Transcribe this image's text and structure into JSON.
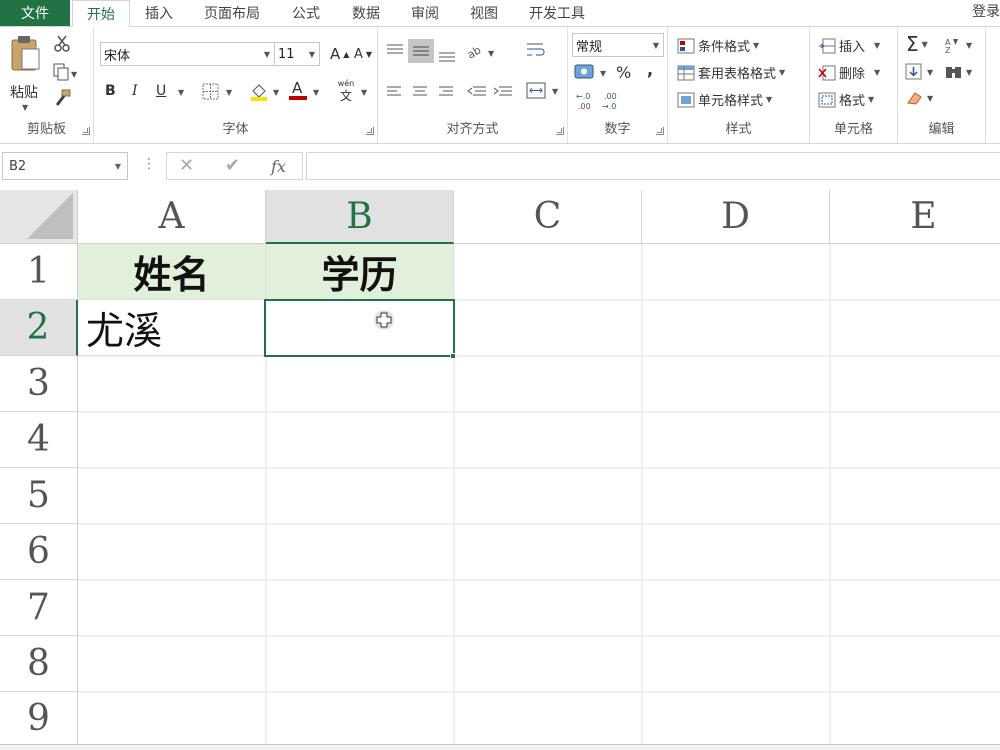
{
  "tabs": {
    "file": "文件",
    "home": "开始",
    "insert": "插入",
    "page_layout": "页面布局",
    "formulas": "公式",
    "data": "数据",
    "review": "审阅",
    "view": "视图",
    "developer": "开发工具",
    "login": "登录"
  },
  "ribbon": {
    "clipboard": {
      "paste": "粘贴",
      "label": "剪贴板"
    },
    "font": {
      "name": "宋体",
      "size": "11",
      "bold": "B",
      "italic": "I",
      "underline": "U",
      "grow": "A",
      "shrink": "A",
      "phonetic_top": "wén",
      "phonetic_bottom": "文",
      "color_letter": "A",
      "label": "字体"
    },
    "alignment": {
      "label": "对齐方式"
    },
    "number": {
      "format": "常规",
      "percent": "%",
      "comma": ",",
      "label": "数字"
    },
    "styles": {
      "conditional": "条件格式",
      "table": "套用表格格式",
      "cell": "单元格样式",
      "label": "样式"
    },
    "cells": {
      "insert": "插入",
      "delete": "删除",
      "format": "格式",
      "label": "单元格"
    },
    "editing": {
      "sum": "Σ",
      "label": "编辑"
    }
  },
  "formula_bar": {
    "name_box": "B2",
    "cancel": "✕",
    "enter": "✔",
    "fx": "fx",
    "content": ""
  },
  "columns": [
    "A",
    "B",
    "C",
    "D",
    "E"
  ],
  "rows": [
    "1",
    "2",
    "3",
    "4",
    "5",
    "6",
    "7",
    "8",
    "9"
  ],
  "cells": {
    "A1": "姓名",
    "B1": "学历",
    "A2": "尤溪",
    "B2": ""
  },
  "selected_cell": "B2",
  "colors": {
    "accent": "#217346",
    "header_fill": "#e2efda"
  }
}
